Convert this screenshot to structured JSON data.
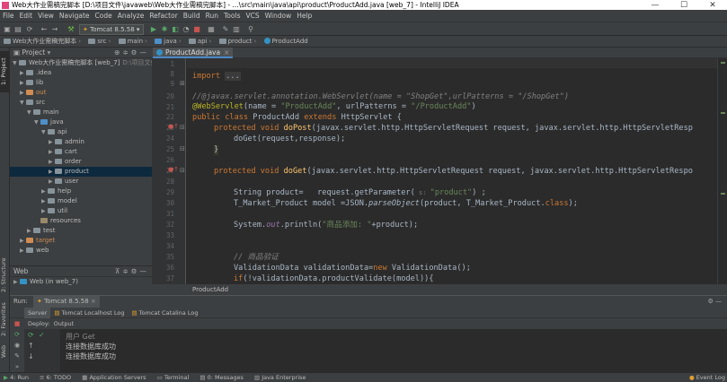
{
  "title_bar": {
    "text": "Web大作业需稿完脚本 [D:\\项目文件\\javaweb\\Web大作业需稿完脚本] - ...\\src\\main\\java\\api\\product\\ProductAdd.java [web_7] - IntelliJ IDEA",
    "minimize": "—",
    "maximize": "☐",
    "close": "✕"
  },
  "menu": [
    "File",
    "Edit",
    "View",
    "Navigate",
    "Code",
    "Analyze",
    "Refactor",
    "Build",
    "Run",
    "Tools",
    "VCS",
    "Window",
    "Help"
  ],
  "toolbar": {
    "run_config": "Tomcat 8.5.58"
  },
  "navbar": {
    "items": [
      "Web大作业需稿完脚本",
      "src",
      "main",
      "java",
      "api",
      "product",
      "ProductAdd"
    ],
    "separator": "›"
  },
  "left_stripe": {
    "project": "1: Project",
    "structure": "2: Structure",
    "favorites": "2: Favorites",
    "web": "Web"
  },
  "project_panel": {
    "title": "Project",
    "tree": [
      {
        "indent": 0,
        "open": true,
        "label": "Web大作业需稿完脚本 [web_7]",
        "note": "D:\\项目文件\\j...",
        "color": "#87939a"
      },
      {
        "indent": 1,
        "open": false,
        "label": ".idea",
        "color": "#87939a"
      },
      {
        "indent": 1,
        "open": false,
        "label": "lib",
        "color": "#87939a"
      },
      {
        "indent": 1,
        "open": false,
        "label": "out",
        "color": "#d08c52",
        "orange": true
      },
      {
        "indent": 1,
        "open": true,
        "label": "src",
        "color": "#87939a"
      },
      {
        "indent": 2,
        "open": true,
        "label": "main",
        "color": "#87939a"
      },
      {
        "indent": 3,
        "open": true,
        "label": "java",
        "color": "#4e8fc9"
      },
      {
        "indent": 4,
        "open": true,
        "label": "api",
        "color": "#87939a"
      },
      {
        "indent": 5,
        "open": false,
        "label": "admin",
        "color": "#87939a"
      },
      {
        "indent": 5,
        "open": false,
        "label": "cart",
        "color": "#87939a"
      },
      {
        "indent": 5,
        "open": false,
        "label": "order",
        "color": "#87939a"
      },
      {
        "indent": 5,
        "open": false,
        "label": "product",
        "color": "#87939a",
        "selected": true
      },
      {
        "indent": 5,
        "open": false,
        "label": "user",
        "color": "#87939a"
      },
      {
        "indent": 4,
        "open": false,
        "label": "help",
        "color": "#87939a"
      },
      {
        "indent": 4,
        "open": false,
        "label": "model",
        "color": "#87939a"
      },
      {
        "indent": 4,
        "open": false,
        "label": "util",
        "color": "#87939a"
      },
      {
        "indent": 3,
        "leaf": true,
        "label": "resources",
        "color": "#9a8a6a"
      },
      {
        "indent": 2,
        "open": false,
        "label": "test",
        "color": "#87939a"
      },
      {
        "indent": 1,
        "open": false,
        "label": "target",
        "color": "#d08c52",
        "orange": true
      },
      {
        "indent": 1,
        "open": false,
        "label": "web",
        "color": "#87939a"
      }
    ]
  },
  "web_panel": {
    "title": "Web",
    "item": "Web (in web_7)"
  },
  "editor": {
    "tab": "ProductAdd.java",
    "line_numbers": [
      "1",
      "8",
      "9",
      "20",
      "21",
      "22",
      "23",
      "24",
      "25",
      "26",
      "27",
      "28",
      "29",
      "30",
      "31",
      "32",
      "33",
      "34",
      "35",
      "36",
      "37",
      "38",
      "39"
    ],
    "breadcrumb": "ProductAdd"
  },
  "code": {
    "l1_kw": "import",
    "l1_fold": "...",
    "l20": "//@javax.servlet.annotation.WebServlet(name = \"ShopGet\",urlPatterns = \"/ShopGet\")",
    "l21_an": "@WebServlet",
    "l21_a": "(name = ",
    "l21_s1": "\"ProductAdd\"",
    "l21_b": ", urlPatterns = ",
    "l21_s2": "\"/ProductAdd\"",
    "l21_c": ")",
    "l22_k1": "public class ",
    "l22_a": "ProductAdd ",
    "l22_k2": "extends ",
    "l22_b": "HttpServlet {",
    "l23_k": "protected void ",
    "l23_fn": "doPost",
    "l23_rest": "(javax.servlet.http.HttpServletRequest request, javax.servlet.http.HttpServletResp",
    "l24": "doGet(request,response);",
    "l25": "}",
    "l27_k": "protected void ",
    "l27_fn": "doGet",
    "l27_rest": "(javax.servlet.http.HttpServletRequest request, javax.servlet.http.HttpServletRespo",
    "l29_a": "String product=   request.getParameter(",
    "l29_hint": " s: ",
    "l29_s": "\"product\"",
    "l29_b": ") ;",
    "l30_a": "T_Market_Product model =JSON.",
    "l30_it": "parseObject",
    "l30_b": "(product, T_Market_Product.",
    "l30_k": "class",
    "l30_c": ");",
    "l32_a": "System.",
    "l32_it": "out",
    "l32_b": ".println(",
    "l32_s": "\"商品添加: \"",
    "l32_c": "+product);",
    "l35": "// 商品验证",
    "l36_a": "ValidationData validationData=",
    "l36_k": "new ",
    "l36_b": "ValidationData();",
    "l37_k": "if",
    "l37_a": "(!validationData.productValidate(model)){"
  },
  "run_panel": {
    "label": "Run:",
    "config": "Tomcat 8.5.58",
    "subtabs": [
      "Server",
      "Tomcat Localhost Log",
      "Tomcat Catalina Log"
    ],
    "deploy": "Deploy:",
    "output": "Output",
    "console": [
      "用户 Get",
      "连接数据库成功",
      "连接数据库成功"
    ]
  },
  "status_bar": [
    "4: Run",
    "6: TODO",
    "Application Servers",
    "Terminal",
    "0: Messages",
    "Java Enterprise"
  ],
  "event_log": "Event Log"
}
